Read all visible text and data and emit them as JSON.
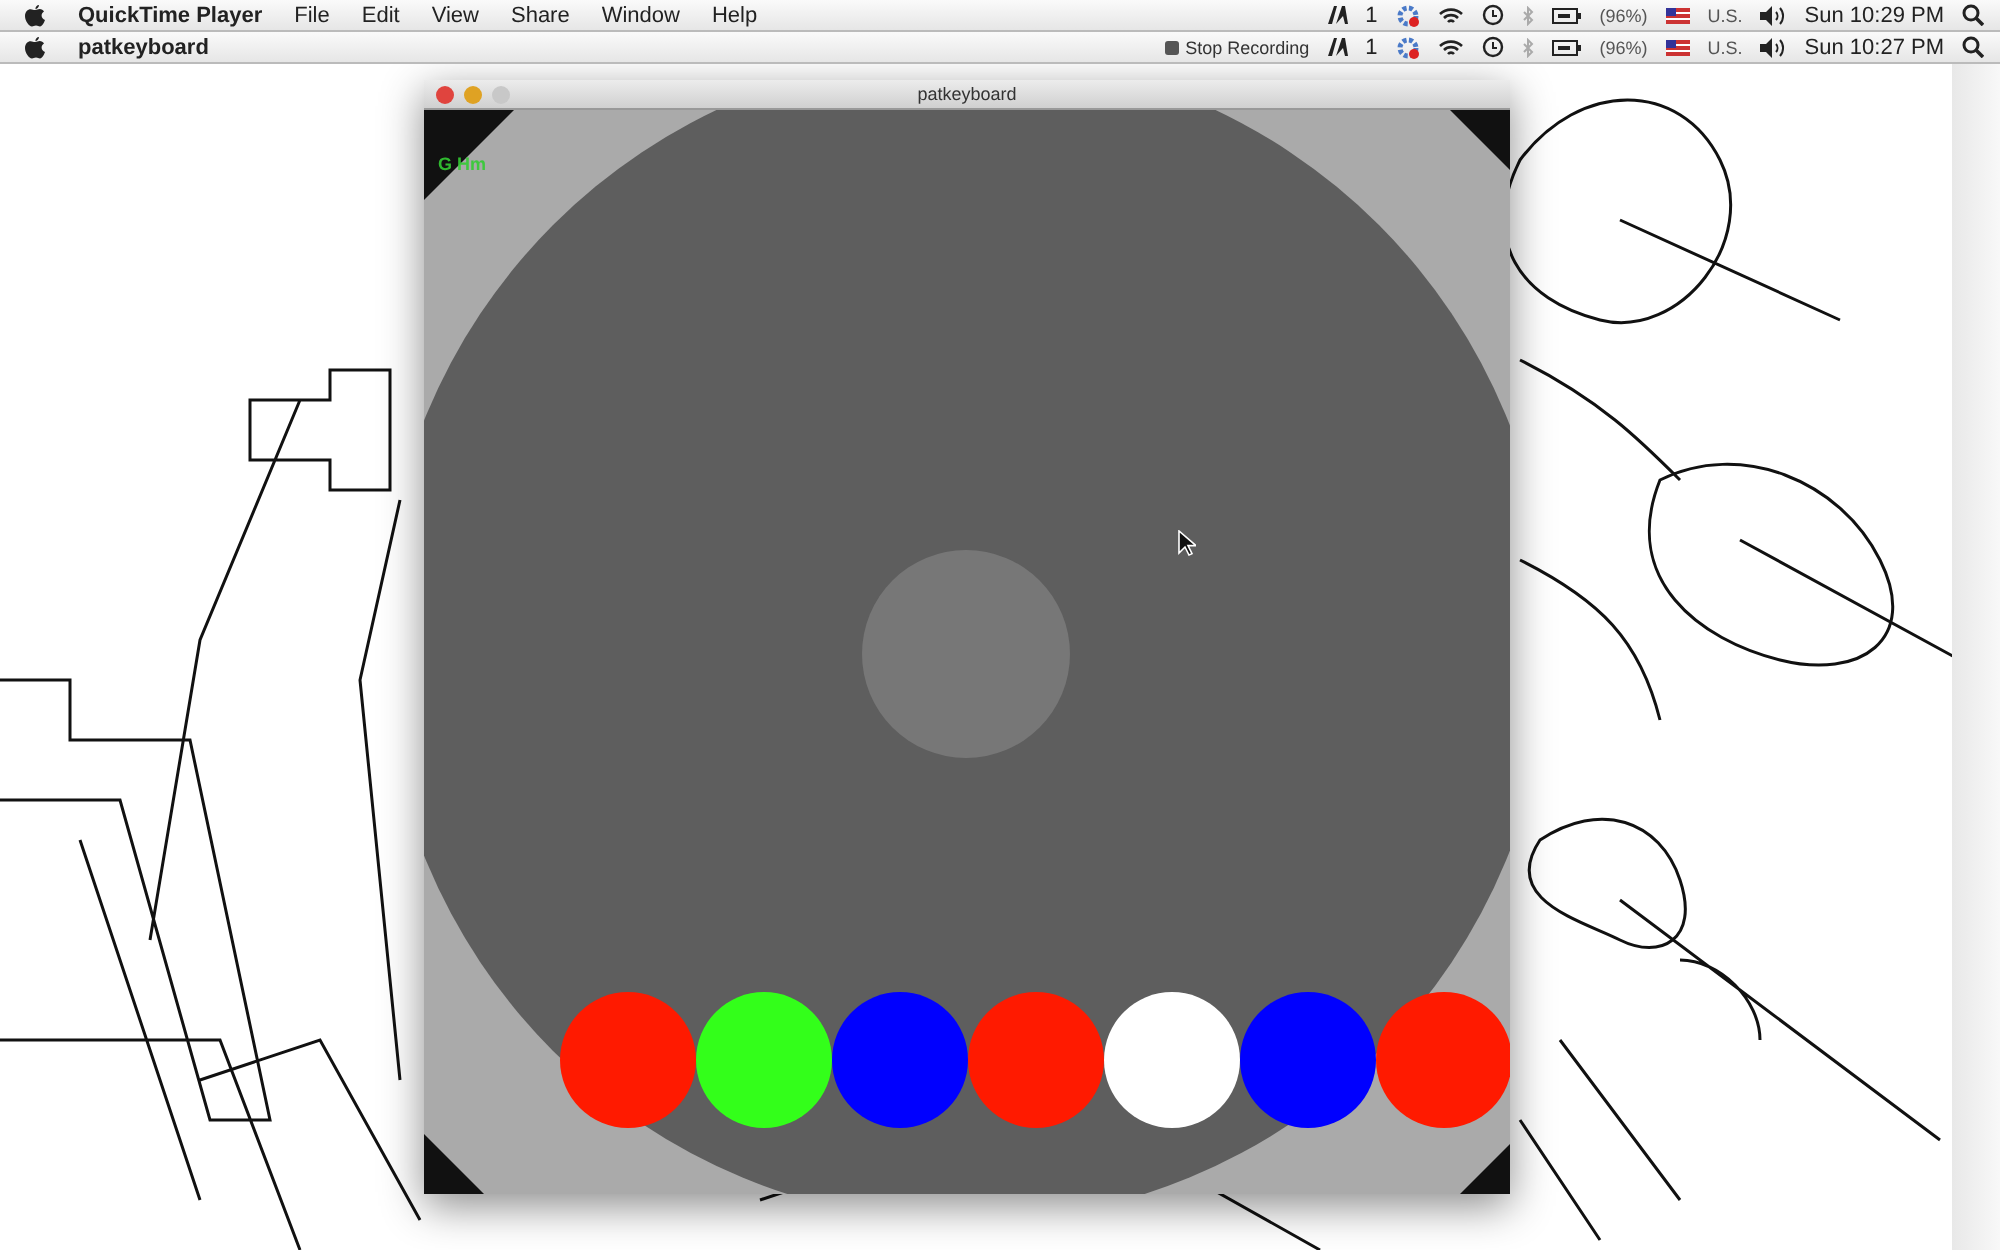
{
  "menubars": [
    {
      "app_name": "QuickTime Player",
      "menus": [
        "File",
        "Edit",
        "View",
        "Share",
        "Window",
        "Help"
      ],
      "adobe_count": "1",
      "battery": "(96%)",
      "input": "U.S.",
      "clock": "Sun 10:29 PM"
    },
    {
      "app_name": "patkeyboard",
      "recording": "Stop Recording",
      "adobe_count": "1",
      "battery": "(96%)",
      "input": "U.S.",
      "clock": "Sun 10:27 PM"
    }
  ],
  "window": {
    "title": "patkeyboard",
    "status_text": "G Hm",
    "keys": [
      {
        "color": "#ff1a00"
      },
      {
        "color": "#33ff1a"
      },
      {
        "color": "#0000ff"
      },
      {
        "color": "#ff1a00"
      },
      {
        "color": "#ffffff"
      },
      {
        "color": "#0000ff"
      },
      {
        "color": "#ff1a00"
      }
    ]
  }
}
